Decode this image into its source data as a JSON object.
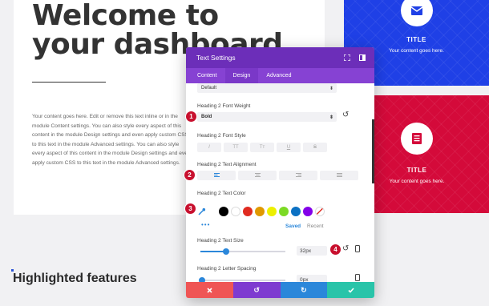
{
  "page": {
    "hero_title": "Welcome to\nyour dashboard",
    "hero_body": "Your content goes here. Edit or remove this text inline or in the module Content settings. You can also style every aspect of this content in the module Design settings and even apply custom CSS to this text in the module Advanced settings. You can also style every aspect of this content in the module Design settings and even apply custom CSS to this text in the module Advanced settings.",
    "highlighted_title": "Highlighted features",
    "cards": [
      {
        "title": "TITLE",
        "text": "Your content goes here.",
        "icon": "envelope-icon",
        "color": "#1f40e6"
      },
      {
        "title": "TITLE",
        "text": "Your content goes here.",
        "icon": "document-icon",
        "color": "#d40a3a"
      }
    ]
  },
  "modal": {
    "title": "Text Settings",
    "tabs": [
      "Content",
      "Design",
      "Advanced"
    ],
    "active_tab": "Design",
    "header_color": "#6c2eb9",
    "top_select": "Default",
    "font_weight": {
      "label": "Heading 2 Font Weight",
      "value": "Bold"
    },
    "font_style": {
      "label": "Heading 2 Font Style",
      "options": [
        "I",
        "TT",
        "Tт",
        "U",
        "S"
      ]
    },
    "text_alignment": {
      "label": "Heading 2 Text Alignment"
    },
    "text_color": {
      "label": "Heading 2 Text Color",
      "swatches": [
        "#000000",
        "#ffffff",
        "#e02b20",
        "#e09900",
        "#edf000",
        "#7cda24",
        "#0c71c3",
        "#8300e9"
      ],
      "saved_label": "Saved",
      "recent_label": "Recent"
    },
    "text_size": {
      "label": "Heading 2 Text Size",
      "value": "32px",
      "level": 0.3
    },
    "letter_spacing": {
      "label": "Heading 2 Letter Spacing",
      "value": "0px",
      "level": 0.0
    },
    "footer_colors": [
      "#ef5555",
      "#7e3bd0",
      "#2b87da",
      "#29c4a9"
    ]
  },
  "badges": [
    "1",
    "2",
    "3",
    "4"
  ]
}
